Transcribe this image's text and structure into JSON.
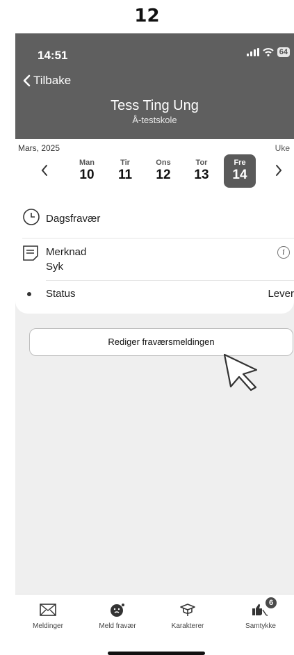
{
  "step": "12",
  "status_bar": {
    "time": "14:51",
    "battery": "64"
  },
  "header": {
    "back_label": "Tilbake",
    "student_name": "Tess Ting Ung",
    "school": "Å-testskole"
  },
  "week": {
    "month": "Mars, 2025",
    "week_label": "Uke",
    "days": [
      {
        "name": "Man",
        "date": "10"
      },
      {
        "name": "Tir",
        "date": "11"
      },
      {
        "name": "Ons",
        "date": "12"
      },
      {
        "name": "Tor",
        "date": "13"
      },
      {
        "name": "Fre",
        "date": "14"
      }
    ],
    "selected_index": 4
  },
  "absence": {
    "type": "Dagsfravær",
    "note_label": "Merknad",
    "note_value": "Syk",
    "status_label": "Status",
    "status_value": "Lever"
  },
  "actions": {
    "edit_label": "Rediger fraværsmeldingen"
  },
  "tabbar": {
    "items": [
      {
        "label": "Meldinger",
        "icon": "envelope-icon"
      },
      {
        "label": "Meld fravær",
        "icon": "sick-face-icon"
      },
      {
        "label": "Karakterer",
        "icon": "graduation-cap-icon"
      },
      {
        "label": "Samtykke",
        "icon": "thumbs-icon",
        "badge": "6"
      }
    ]
  },
  "colors": {
    "header_bg": "#5f5f5f",
    "selected_day_bg": "#5a5a5a",
    "page_bg": "#efefef"
  }
}
